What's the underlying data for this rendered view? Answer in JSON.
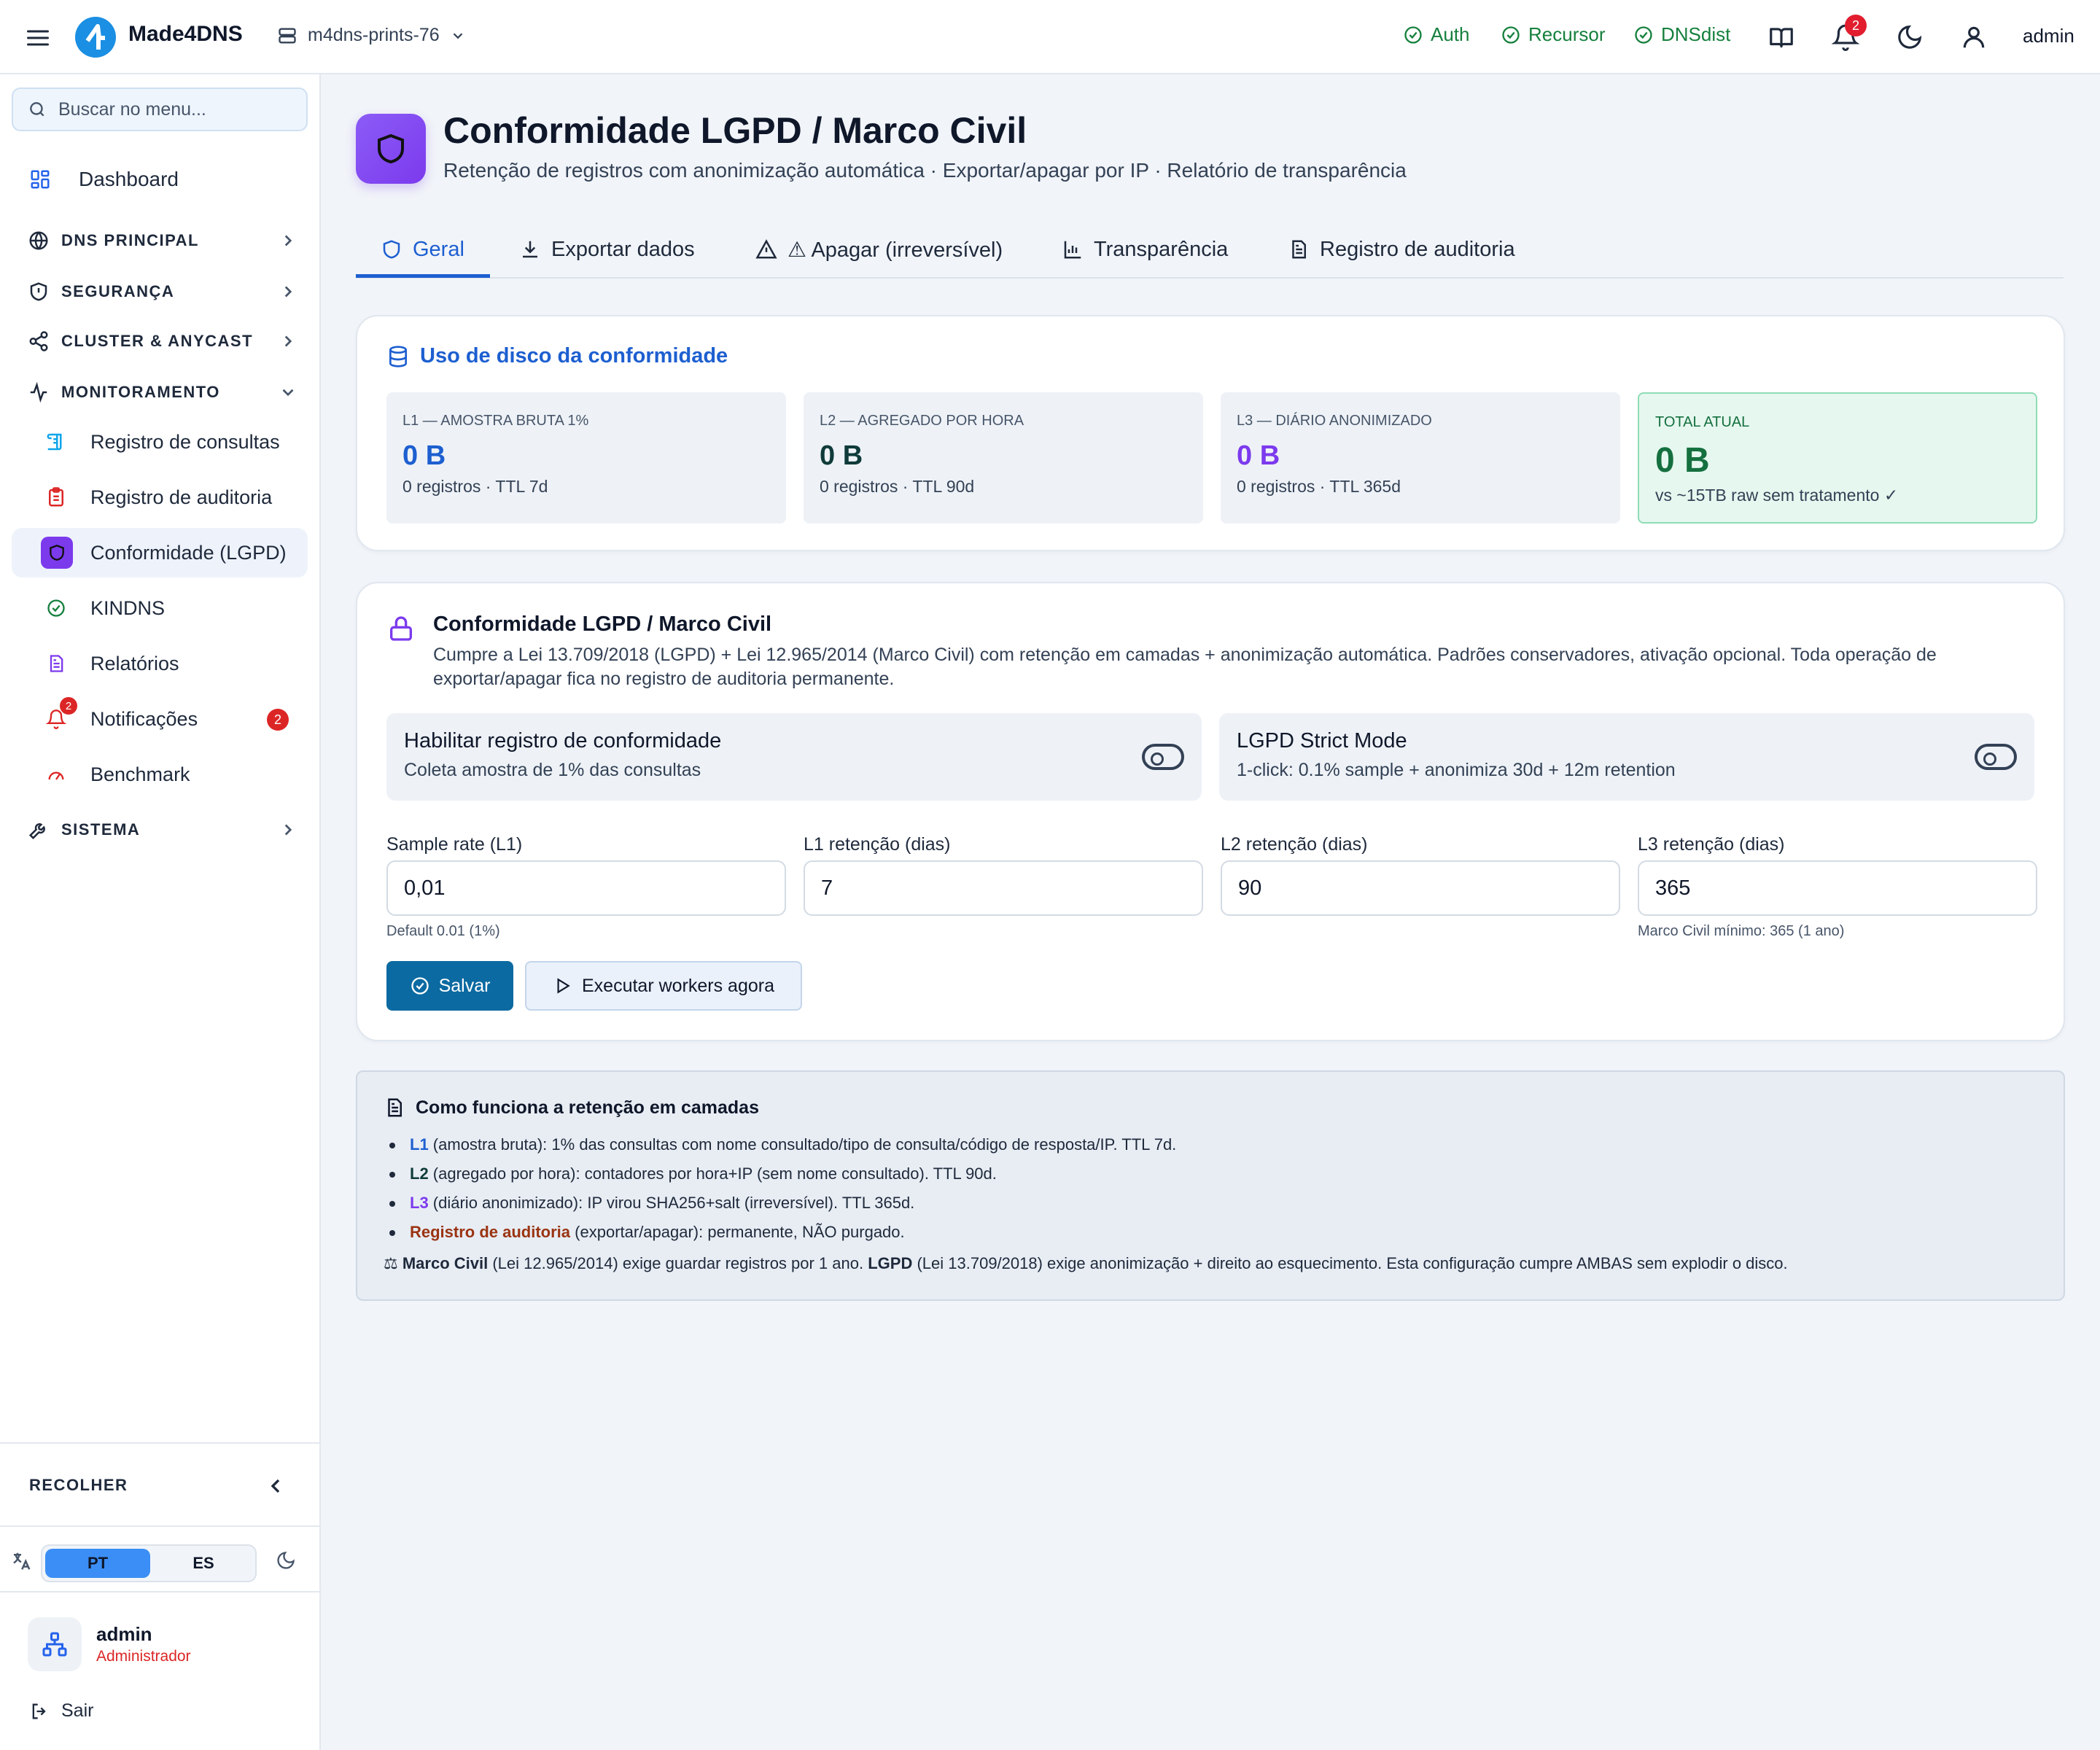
{
  "topbar": {
    "brand": "Made4DNS",
    "server": "m4dns-prints-76",
    "services": [
      "Auth",
      "Recursor",
      "DNSdist"
    ],
    "notifications": "2",
    "user": "admin"
  },
  "sidebar": {
    "search_placeholder": "Buscar no menu...",
    "dashboard": "Dashboard",
    "sections": {
      "dns": "DNS PRINCIPAL",
      "security": "SEGURANÇA",
      "cluster": "CLUSTER & ANYCAST",
      "monitoring": "MONITORAMENTO",
      "system": "SISTEMA"
    },
    "monitoring_items": [
      "Registro de consultas",
      "Registro de auditoria",
      "Conformidade (LGPD)",
      "KINDNS",
      "Relatórios",
      "Notificações",
      "Benchmark"
    ],
    "notifications_badge": "2",
    "collapse": "RECOLHER",
    "lang_pt": "PT",
    "lang_es": "ES",
    "user_name": "admin",
    "user_role": "Administrador",
    "logout": "Sair"
  },
  "page": {
    "title": "Conformidade LGPD / Marco Civil",
    "subtitle": "Retenção de registros com anonimização automática · Exportar/apagar por IP · Relatório de transparência",
    "tabs": [
      "Geral",
      "Exportar dados",
      "⚠ Apagar (irreversível)",
      "Transparência",
      "Registro de auditoria"
    ]
  },
  "disk": {
    "title": "Uso de disco da conformidade",
    "stats": [
      {
        "label": "L1 — AMOSTRA BRUTA 1%",
        "value": "0 B",
        "sub": "0 registros · TTL 7d",
        "color": "#1d5fd0"
      },
      {
        "label": "L2 — AGREGADO POR HORA",
        "value": "0 B",
        "sub": "0 registros · TTL 90d",
        "color": "#0f3b3a"
      },
      {
        "label": "L3 — DIÁRIO ANONIMIZADO",
        "value": "0 B",
        "sub": "0 registros · TTL 365d",
        "color": "#7c3aed"
      },
      {
        "label": "TOTAL ATUAL",
        "value": "0 B",
        "sub": "vs ~15TB raw sem tratamento ✓",
        "color": "#15703f"
      }
    ]
  },
  "compliance": {
    "title": "Conformidade LGPD / Marco Civil",
    "description": "Cumpre a Lei 13.709/2018 (LGPD) + Lei 12.965/2014 (Marco Civil) com retenção em camadas + anonimização automática. Padrões conservadores, ativação opcional. Toda operação de exportar/apagar fica no registro de auditoria permanente.",
    "toggles": [
      {
        "title": "Habilitar registro de conformidade",
        "desc": "Coleta amostra de 1% das consultas"
      },
      {
        "title": "LGPD Strict Mode",
        "desc": "1-click: 0.1% sample + anonimiza 30d + 12m retention"
      }
    ],
    "fields": [
      {
        "label": "Sample rate (L1)",
        "value": "0,01",
        "hint": "Default 0.01 (1%)"
      },
      {
        "label": "L1 retenção (dias)",
        "value": "7",
        "hint": ""
      },
      {
        "label": "L2 retenção (dias)",
        "value": "90",
        "hint": ""
      },
      {
        "label": "L3 retenção (dias)",
        "value": "365",
        "hint": "Marco Civil mínimo: 365 (1 ano)"
      }
    ],
    "save": "Salvar",
    "run": "Executar workers agora"
  },
  "info": {
    "title": "Como funciona a retenção em camadas",
    "items": [
      {
        "key": "L1",
        "text": " (amostra bruta): 1% das consultas com nome consultado/tipo de consulta/código de resposta/IP. TTL 7d."
      },
      {
        "key": "L2",
        "text": " (agregado por hora): contadores por hora+IP (sem nome consultado). TTL 90d."
      },
      {
        "key": "L3",
        "text": " (diário anonimizado): IP virou SHA256+salt (irreversível). TTL 365d."
      },
      {
        "key": "Registro de auditoria",
        "text": " (exportar/apagar): permanente, NÃO purgado."
      }
    ],
    "foot_icon": "⚖",
    "foot_marco": "Marco Civil",
    "foot_mid": " (Lei 12.965/2014) exige guardar registros por 1 ano. ",
    "foot_lgpd": "LGPD",
    "foot_end": " (Lei 13.709/2018) exige anonimização + direito ao esquecimento. Esta configuração cumpre AMBAS sem explodir o disco."
  }
}
